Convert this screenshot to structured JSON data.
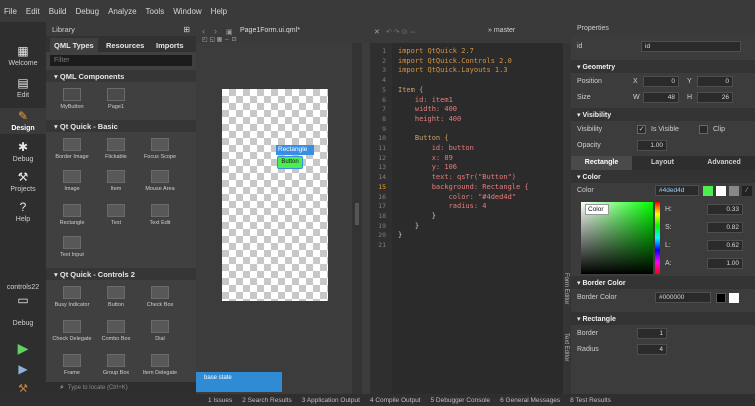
{
  "menu": [
    "File",
    "Edit",
    "Build",
    "Debug",
    "Analyze",
    "Tools",
    "Window",
    "Help"
  ],
  "modes": [
    {
      "label": "Welcome",
      "icon": "grid-icon"
    },
    {
      "label": "Edit",
      "icon": "doc-icon"
    },
    {
      "label": "Design",
      "icon": "pencil-icon"
    },
    {
      "label": "Debug",
      "icon": "bug-icon"
    },
    {
      "label": "Projects",
      "icon": "wrench-icon"
    },
    {
      "label": "Help",
      "icon": "help-icon"
    },
    {
      "label": "controls22",
      "icon": "monitor-icon"
    },
    {
      "label": "Debug",
      "icon": "monitor-icon"
    }
  ],
  "library": {
    "title": "Library",
    "tabs": [
      "QML Types",
      "Resources",
      "Imports"
    ],
    "filter_placeholder": "Filter",
    "sections": [
      "QML Components",
      "Qt Quick - Basic",
      "Qt Quick - Controls 2"
    ],
    "components": [
      "MyButton",
      "Page1"
    ],
    "basic": [
      "Border Image",
      "Flickable",
      "Focus Scope",
      "Image",
      "Item",
      "Mouse Area",
      "Rectangle",
      "Text",
      "Text Edit",
      "Text Input"
    ],
    "controls": [
      "Busy Indicator",
      "Button",
      "Check Box",
      "Check Delegate",
      "Combo Box",
      "Dial",
      "Frame",
      "Group Box",
      "Item Delegate"
    ],
    "locator_placeholder": "Type to locate (Ctrl+K)"
  },
  "editor": {
    "file": "Page1Form.ui.qml*",
    "branch": "master",
    "selection_label": "Rectangle",
    "button_label": "Button",
    "base_state": "base state",
    "side_tab": "Form Editor",
    "side_tab2": "Text Editor"
  },
  "code": [
    {
      "n": "1",
      "t": "import QtQuick 2.7"
    },
    {
      "n": "2",
      "t": "import QtQuick.Controls 2.0"
    },
    {
      "n": "3",
      "t": "import QtQuick.Layouts 1.3"
    },
    {
      "n": "4",
      "t": ""
    },
    {
      "n": "5",
      "t": "Item {"
    },
    {
      "n": "6",
      "t": "    id: item1"
    },
    {
      "n": "7",
      "t": "    width: 400"
    },
    {
      "n": "8",
      "t": "    height: 400"
    },
    {
      "n": "9",
      "t": ""
    },
    {
      "n": "10",
      "t": "    Button {"
    },
    {
      "n": "11",
      "t": "        id: button"
    },
    {
      "n": "12",
      "t": "        x: 89"
    },
    {
      "n": "13",
      "t": "        y: 106"
    },
    {
      "n": "14",
      "t": "        text: qsTr(\"Button\")"
    },
    {
      "n": "15",
      "t": "        background: Rectangle {"
    },
    {
      "n": "16",
      "t": "            color: \"#4ded4d\""
    },
    {
      "n": "17",
      "t": "            radius: 4"
    },
    {
      "n": "18",
      "t": "        }"
    },
    {
      "n": "19",
      "t": "    }"
    },
    {
      "n": "20",
      "t": "}"
    },
    {
      "n": "21",
      "t": ""
    }
  ],
  "properties": {
    "title": "Properties",
    "id_label": "id",
    "id_value": "id",
    "geometry": "Geometry",
    "position": "Position",
    "x_label": "X",
    "x_value": "0",
    "y_label": "Y",
    "y_value": "0",
    "size": "Size",
    "w_label": "W",
    "w_value": "48",
    "h_label": "H",
    "h_value": "26",
    "visibility": "Visibility",
    "visibility_label": "Visibility",
    "is_visible": "Is Visible",
    "clip": "Clip",
    "opacity_label": "Opacity",
    "opacity_value": "1.00",
    "tabs": [
      "Rectangle",
      "Layout",
      "Advanced"
    ],
    "color_section": "Color",
    "color_label": "Color",
    "color_value": "#4ded4d",
    "color_tooltip": "Color",
    "hsla": [
      {
        "k": "H:",
        "v": "0.33"
      },
      {
        "k": "S:",
        "v": "0.82"
      },
      {
        "k": "L:",
        "v": "0.62"
      },
      {
        "k": "A:",
        "v": "1.00"
      }
    ],
    "border_color_section": "Border Color",
    "border_color_label": "Border Color",
    "border_color_value": "#000000",
    "rectangle_section": "Rectangle",
    "border_label": "Border",
    "border_value": "1",
    "radius_label": "Radius",
    "radius_value": "4"
  },
  "bottom_tabs": [
    "1 Issues",
    "2 Search Results",
    "3 Application Output",
    "4 Compile Output",
    "5 Debugger Console",
    "6 General Messages",
    "8 Test Results"
  ],
  "colors": {
    "accent": "#4ded4d",
    "selection": "#3a8ee6",
    "state": "#2f8cd4"
  }
}
